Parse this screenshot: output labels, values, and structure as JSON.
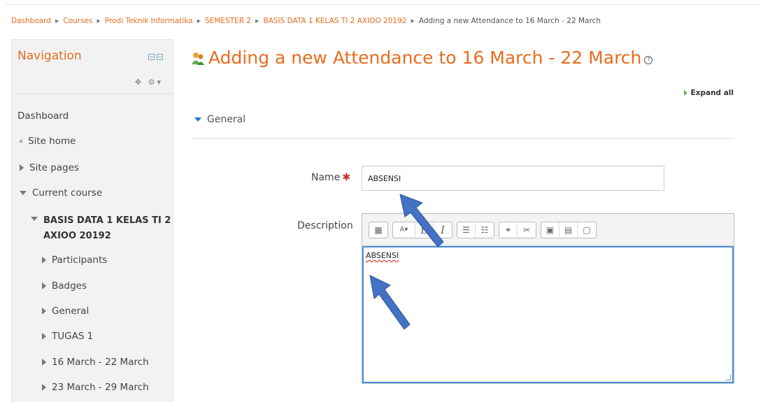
{
  "breadcrumb": [
    {
      "label": "Dashboard"
    },
    {
      "label": "Courses"
    },
    {
      "label": "Prodi Teknik Informatika"
    },
    {
      "label": "SEMESTER 2"
    },
    {
      "label": "BASIS DATA 1 KELAS TI 2 AXIOO 20192"
    },
    {
      "label": "Adding a new Attendance to 16 March - 22 March"
    }
  ],
  "navigation": {
    "title": "Navigation",
    "items": {
      "dashboard": "Dashboard",
      "site_home": "Site home",
      "site_pages": "Site pages",
      "current_course": "Current course",
      "course_line1": "BASIS DATA 1 KELAS TI 2",
      "course_line2": "AXIOO 20192",
      "participants": "Participants",
      "badges": "Badges",
      "general": "General",
      "tugas1": "TUGAS 1",
      "week1": "16 March - 22 March",
      "week2": "23 March - 29 March"
    }
  },
  "main": {
    "title": "Adding a new Attendance to 16 March - 22 March",
    "expand_all": "Expand all",
    "section": "General",
    "name_label": "Name",
    "name_value": "ABSENSI",
    "description_label": "Description",
    "description_value": "ABSENSI"
  },
  "colors": {
    "accent": "#e86c1f",
    "focus": "#4a90d9",
    "arrow": "#4472c4"
  }
}
